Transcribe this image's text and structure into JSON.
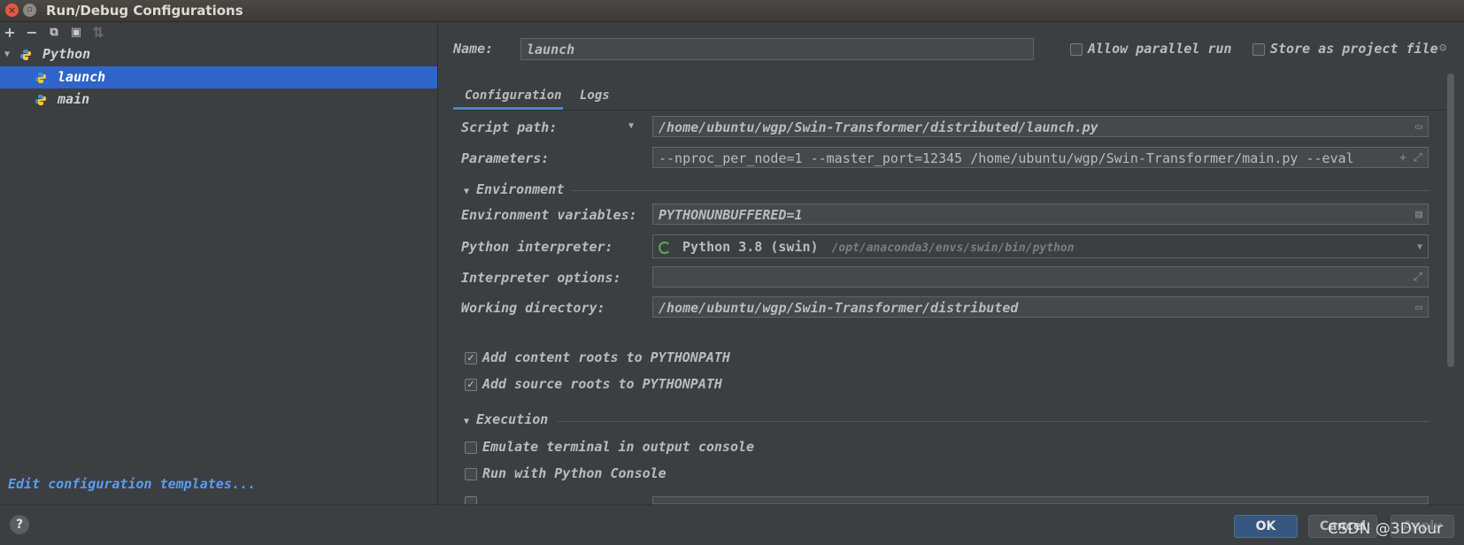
{
  "window": {
    "title": "Run/Debug Configurations",
    "close_glyph": "×",
    "max_glyph": "▫"
  },
  "toolbar": {
    "add": "+",
    "remove": "−",
    "copy": "⧉",
    "folder": "▣",
    "sort": "⇅"
  },
  "tree": {
    "group_label": "Python",
    "items": [
      {
        "label": "launch",
        "selected": true
      },
      {
        "label": "main",
        "selected": false
      }
    ]
  },
  "left_footer": {
    "edit_templates": "Edit configuration templates..."
  },
  "header": {
    "name_label": "Name:",
    "name_value": "launch",
    "allow_parallel_label": "Allow parallel run",
    "store_project_label": "Store as project file"
  },
  "tabs": [
    {
      "label": "Configuration",
      "active": true
    },
    {
      "label": "Logs",
      "active": false
    }
  ],
  "config": {
    "script_path_label": "Script path:",
    "script_path_value": "/home/ubuntu/wgp/Swin-Transformer/distributed/launch.py",
    "parameters_label": "Parameters:",
    "parameters_value": "--nproc_per_node=1 --master_port=12345 /home/ubuntu/wgp/Swin-Transformer/main.py --eval",
    "environment_section": "Environment",
    "env_vars_label": "Environment variables:",
    "env_vars_value": "PYTHONUNBUFFERED=1",
    "interpreter_label": "Python interpreter:",
    "interpreter_name": "Python 3.8 (swin)",
    "interpreter_path": "/opt/anaconda3/envs/swin/bin/python",
    "interp_options_label": "Interpreter options:",
    "interp_options_value": "",
    "working_dir_label": "Working directory:",
    "working_dir_value": "/home/ubuntu/wgp/Swin-Transformer/distributed",
    "add_content_roots_label": "Add content roots to PYTHONPATH",
    "add_source_roots_label": "Add source roots to PYTHONPATH",
    "execution_section": "Execution",
    "emulate_terminal_label": "Emulate terminal in output console",
    "run_console_label": "Run with Python Console"
  },
  "buttons": {
    "ok": "OK",
    "cancel": "Cancel",
    "apply": "Apply",
    "help": "?"
  },
  "watermark": "CSDN @3DYour"
}
